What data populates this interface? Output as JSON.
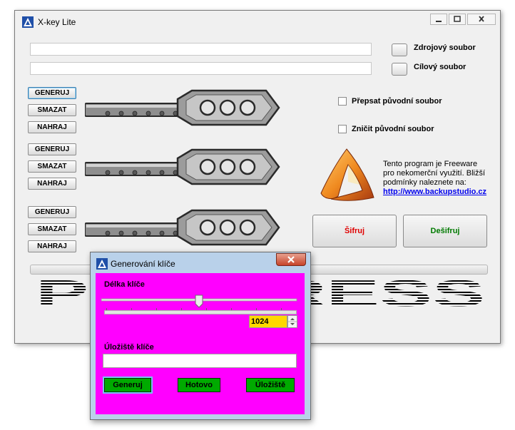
{
  "window": {
    "title": "X-key Lite",
    "controls": {
      "minimize": "minimize-icon",
      "maximize": "maximize-icon",
      "close": "close-icon"
    }
  },
  "files": {
    "source_value": "",
    "target_value": "",
    "source_label": "Zdrojový soubor",
    "target_label": "Cílový soubor"
  },
  "key_rows": [
    {
      "generate": "GENERUJ",
      "clear": "SMAZAT",
      "load": "NAHRAJ"
    },
    {
      "generate": "GENERUJ",
      "clear": "SMAZAT",
      "load": "NAHRAJ"
    },
    {
      "generate": "GENERUJ",
      "clear": "SMAZAT",
      "load": "NAHRAJ"
    }
  ],
  "options": {
    "overwrite_label": "Přepsat původní soubor",
    "destroy_label": "Zničit původní soubor",
    "overwrite_checked": false,
    "destroy_checked": false
  },
  "info": {
    "text": "Tento program je Freeware pro nekomerční využití. Bližší podmínky naleznete na:",
    "link": "http://www.backupstudio.cz"
  },
  "actions": {
    "encrypt": "Šifruj",
    "decrypt": "Dešifruj",
    "encrypt_color": "#e00000",
    "decrypt_color": "#007a00"
  },
  "progress": {
    "text": "PROGRESS",
    "value": 0
  },
  "dialog": {
    "title": "Generování klíče",
    "key_length_label": "Délka klíče",
    "key_length_value": "1024",
    "slider_fraction": 0.5,
    "storage_label": "Úložiště klíče",
    "storage_value": "",
    "buttons": {
      "generate": "Generuj",
      "done": "Hotovo",
      "storage": "Úložiště"
    },
    "body_color": "#ff00ff"
  }
}
